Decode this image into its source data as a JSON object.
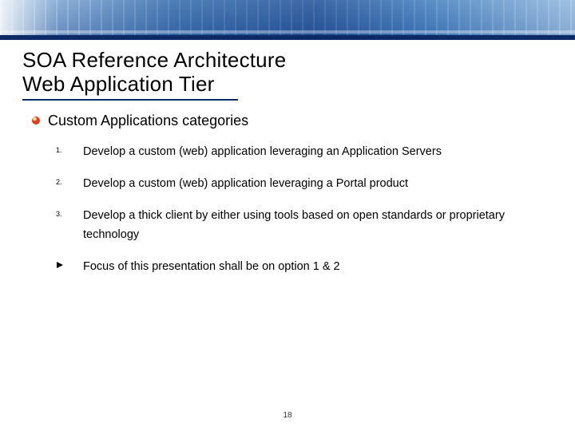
{
  "title": {
    "line1": "SOA Reference Architecture",
    "line2": "Web Application Tier"
  },
  "subheading": "Custom Applications categories",
  "items": [
    {
      "marker": "1.",
      "text": "Develop a custom (web) application leveraging an Application Servers"
    },
    {
      "marker": "2.",
      "text": "Develop a custom (web) application leveraging a Portal product"
    },
    {
      "marker": "3.",
      "text": "Develop a thick client by either using tools based on open standards or proprietary technology"
    },
    {
      "marker": "arrow",
      "text": "Focus of this presentation shall be on option 1 & 2"
    }
  ],
  "page_number": "18"
}
